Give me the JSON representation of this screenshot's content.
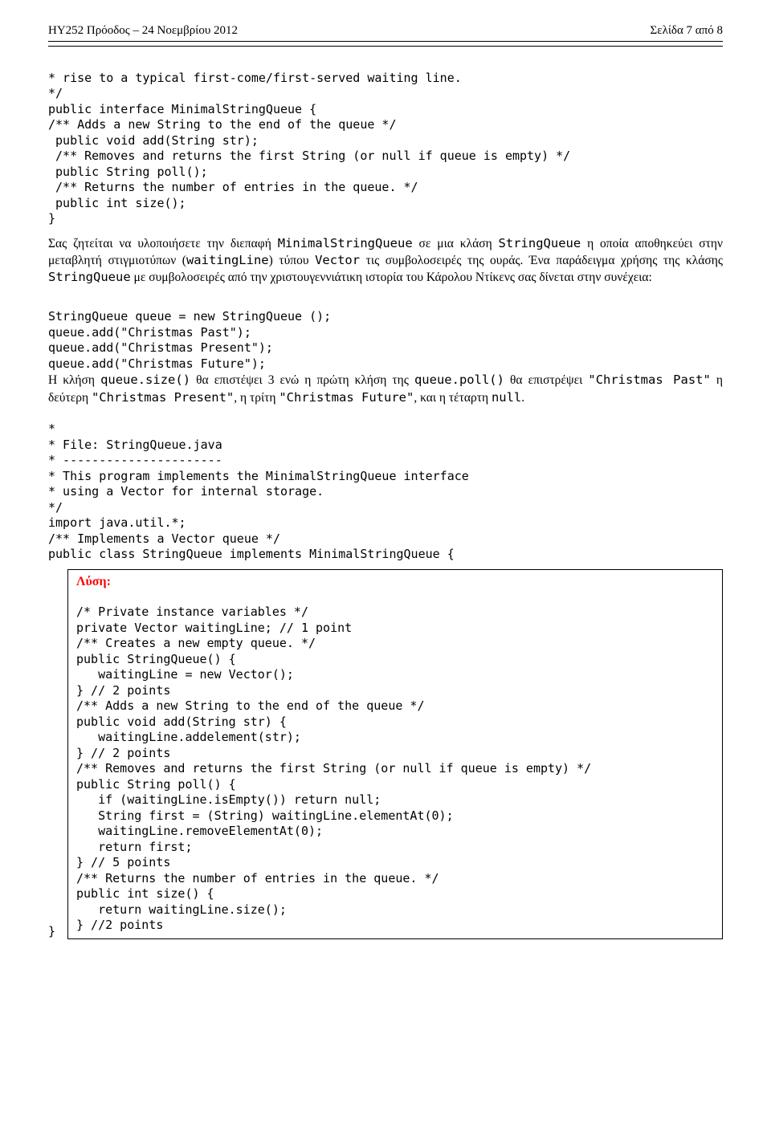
{
  "header": {
    "left": "ΗΥ252 Πρόοδος – 24 Νοεμβρίου 2012",
    "right": "Σελίδα 7 από 8"
  },
  "block1": {
    "line1": "* rise to a typical first-come/first-served waiting line.",
    "line2": "*/",
    "line3": "public interface MinimalStringQueue {",
    "line4": "/** Adds a new String to the end of the queue */",
    "line5": " public void add(String str);",
    "line6": " /** Removes and returns the first String (or null if queue is empty) */",
    "line7": " public String poll();",
    "line8": " /** Returns the number of entries in the queue. */",
    "line9": " public int size();",
    "line10": "}"
  },
  "para1": {
    "t1": "Σας ζητείται να υλοποιήσετε την διεπαφή ",
    "c1": "MinimalStringQueue",
    "t2": " σε μια κλάση ",
    "c2": "StringQueue",
    "t3": " η οποία αποθηκεύει στην μεταβλητή στιγμιοτύπων (",
    "c3": "waitingLine",
    "t4": ") τύπου ",
    "c4": "Vector",
    "t5": " τις συμβολοσειρές της ουράς. Ένα παράδειγμα χρήσης της κλάσης ",
    "c5": "StringQueue",
    "t6": " με συμβολοσειρές από την χριστουγεννιάτικη ιστορία του Κάρολου Ντίκενς σας δίνεται στην συνέχεια:"
  },
  "code2": {
    "l1": "StringQueue queue = new StringQueue ();",
    "l2": "queue.add(\"Christmas Past\");",
    "l3": "queue.add(\"Christmas Present\");",
    "l4": "queue.add(\"Christmas Future\");"
  },
  "para2": {
    "t1": "Η κλήση ",
    "c1": "queue.size()",
    "t2": " θα επιστέψει 3 ενώ η πρώτη κλήση της ",
    "c2": "queue.poll()",
    "t3": "  θα επιστρέψει ",
    "c3": "\"Christmas Past\"",
    "t4": " η δεύτερη  ",
    "c4": "\"Christmas Present\"",
    "t5": ", η τρίτη ",
    "c5": "\"Christmas Future\"",
    "t6": ", και η τέταρτη ",
    "c6": "null",
    "t7": "."
  },
  "block3": {
    "l1": "*",
    "l2": "* File: StringQueue.java",
    "l3": "* ----------------------",
    "l4": "* This program implements the MinimalStringQueue interface",
    "l5": "* using a Vector for internal storage.",
    "l6": "*/",
    "l7": "import java.util.*;",
    "l8": "/** Implements a Vector queue */",
    "l9": "public class StringQueue implements MinimalStringQueue {"
  },
  "solution": {
    "label": "Λύση:",
    "l1": "/* Private instance variables */",
    "l2": "private Vector waitingLine; // 1 point",
    "l3": "/** Creates a new empty queue. */",
    "l4": "public StringQueue() {",
    "l5": "   waitingLine = new Vector();",
    "l6": "} // 2 points",
    "l7": "/** Adds a new String to the end of the queue */",
    "l8": "public void add(String str) {",
    "l9": "   waitingLine.addelement(str);",
    "l10": "} // 2 points",
    "l11": "/** Removes and returns the first String (or null if queue is empty) */",
    "l12": "public String poll() {",
    "l13": "   if (waitingLine.isEmpty()) return null;",
    "l14": "   String first = (String) waitingLine.elementAt(0);",
    "l15": "   waitingLine.removeElementAt(0);",
    "l16": "   return first;",
    "l17": "} // 5 points",
    "l18": "/** Returns the number of entries in the queue. */",
    "l19": "public int size() {",
    "l20": "   return waitingLine.size();",
    "l21": "} //2 points"
  },
  "closeBrace": "}"
}
